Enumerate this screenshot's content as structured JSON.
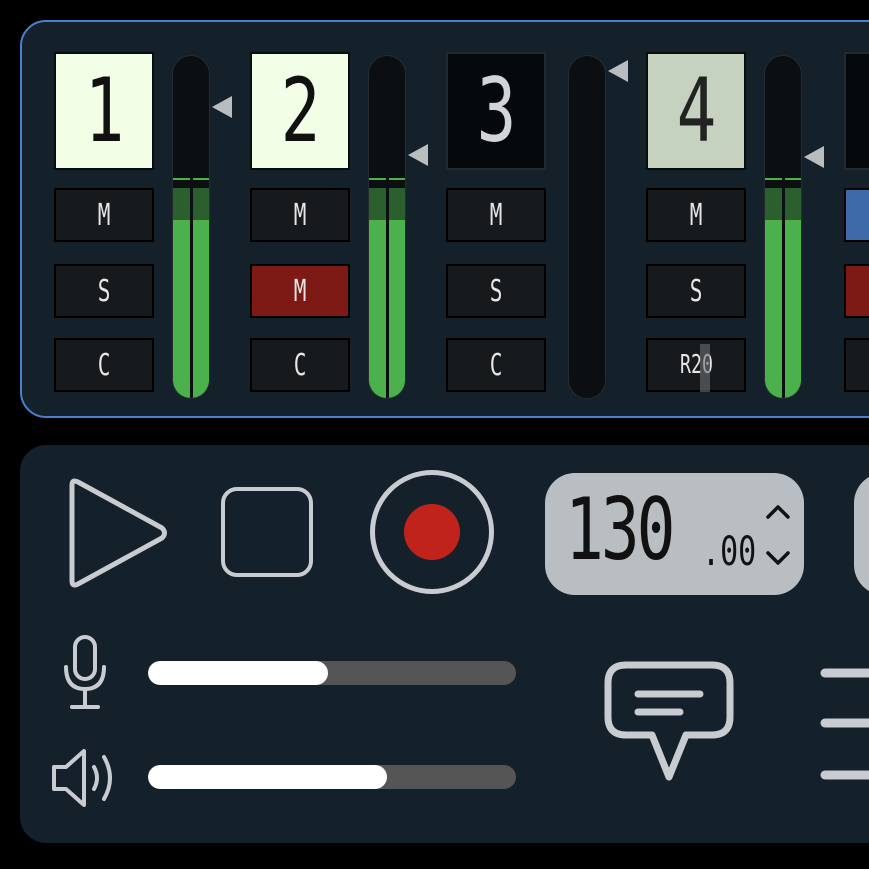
{
  "mixer": {
    "channels": [
      {
        "display": "1",
        "display_state": "lit",
        "mute": "M",
        "solo": "S",
        "pan": "C",
        "mute_active": false,
        "level": 0.65,
        "dark_level": 0.72,
        "peak": 0.64
      },
      {
        "display": "2",
        "display_state": "lit",
        "mute": "M",
        "solo": "M",
        "pan": "C",
        "solo_active": true,
        "level": 0.65,
        "dark_level": 0.72,
        "peak": 0.64
      },
      {
        "display": "3",
        "display_state": "dark",
        "mute": "M",
        "solo": "S",
        "pan": "C",
        "level": 0,
        "dark_level": 0,
        "peak": 0
      },
      {
        "display": "4",
        "display_state": "dim",
        "mute": "M",
        "solo": "S",
        "pan": "R20",
        "level": 0.65,
        "dark_level": 0.72,
        "peak": 0.64
      }
    ]
  },
  "transport": {
    "play_icon": "play-icon",
    "stop_icon": "stop-icon",
    "record_icon": "record-icon",
    "tempo_integer": "130",
    "tempo_decimal": ".00",
    "mic_icon": "microphone-icon",
    "speaker_icon": "speaker-icon",
    "input_volume": 0.49,
    "output_volume": 0.65,
    "chat_icon": "chat-bubble-icon",
    "menu_icon": "menu-icon"
  },
  "colors": {
    "panel": "#14202a",
    "border": "#4a7fd0",
    "meter_green": "#4cb14c",
    "record_red": "#c0231b",
    "active_red": "#7e1a16"
  }
}
